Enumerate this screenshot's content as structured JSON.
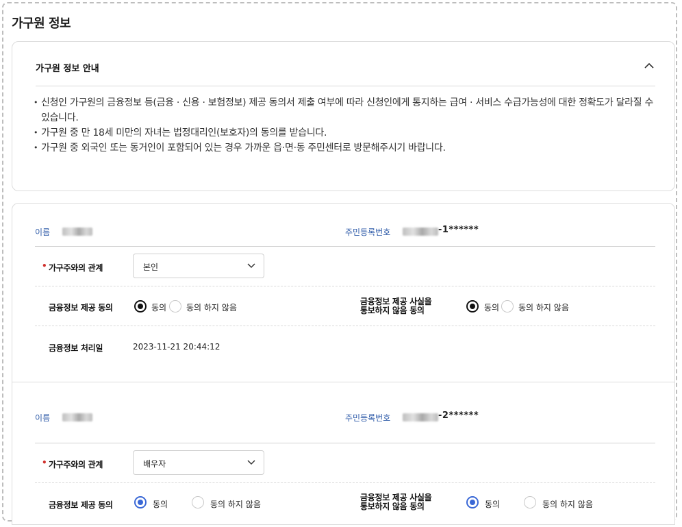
{
  "page": {
    "title": "가구원 정보"
  },
  "guide": {
    "title": "가구원 정보 안내",
    "notices": [
      "신청인 가구원의 금융정보 등(금융 · 신용 · 보험정보) 제공 동의서 제출 여부에 따라 신청인에게 통지하는 급여 · 서비스 수급가능성에 대한 정확도가 달라질 수 있습니다.",
      "가구원 중 만 18세 미만의 자녀는 법정대리인(보호자)의 동의를 받습니다.",
      "가구원 중 외국인 또는 동거인이 포함되어 있는 경우 가까운 읍·면·동 주민센터로 방문해주시기 바랍니다."
    ]
  },
  "labels": {
    "name": "이름",
    "rrn": "주민등록번호",
    "relation": "가구주와의 관계",
    "required_mark": "•",
    "fin_consent": "금융정보 제공 동의",
    "notify_consent_line1": "금융정보 제공 사실을",
    "notify_consent_line2": "통보하지 않음 동의",
    "processed_date": "금융정보 처리일",
    "agree": "동의",
    "disagree": "동의 하지 않음"
  },
  "members": [
    {
      "rrn_suffix": "-1******",
      "relation": "본인",
      "fin_consent": "동의",
      "notify_consent": "동의",
      "processed_date": "2023-11-21 20:44:12"
    },
    {
      "rrn_suffix": "-2******",
      "relation": "배우자",
      "fin_consent": "동의",
      "notify_consent": "동의"
    }
  ],
  "colors": {
    "accent_blue": "#3a68d6",
    "label_blue": "#2d5aa8",
    "required_red": "#d0312d"
  }
}
